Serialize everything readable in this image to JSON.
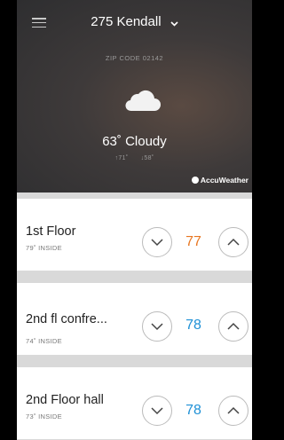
{
  "header": {
    "location": "275 Kendall",
    "zip": "ZIP CODE 02142",
    "temperature": "63˚ Cloudy",
    "high": "↑71˚",
    "low": "↓58˚",
    "attribution": "AccuWeather"
  },
  "zones": [
    {
      "name": "1st Floor",
      "inside": "79˚ INSIDE",
      "setpoint": "77",
      "color": "#e87722"
    },
    {
      "name": "2nd fl confre...",
      "inside": "74˚ INSIDE",
      "setpoint": "78",
      "color": "#1e90d6"
    },
    {
      "name": "2nd Floor hall",
      "inside": "73˚ INSIDE",
      "setpoint": "78",
      "color": "#1e90d6"
    }
  ],
  "colors": {
    "background": "#000000",
    "divider": "#d9d9d9"
  },
  "icons": [
    "menu-icon",
    "chevron-down-icon",
    "cloud-icon",
    "accuweather-icon",
    "chevron-down-icon",
    "chevron-up-icon"
  ]
}
